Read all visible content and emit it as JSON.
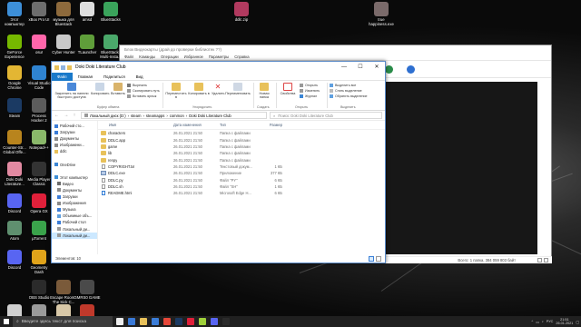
{
  "desktop": {
    "icons": [
      {
        "label": "Этот компьютер",
        "color": "#3d8fd8"
      },
      {
        "label": "xBox Pro UI",
        "color": "#6e6e6e"
      },
      {
        "label": "музыка для Bluestack",
        "color": "#8e6a3c"
      },
      {
        "label": "amsd",
        "color": "#dddddd"
      },
      {
        "label": "BlueStacks",
        "color": "#3aa35b"
      },
      {
        "label": "GeForce Experience",
        "color": "#76b900"
      },
      {
        "label": "osu!",
        "color": "#ff66aa"
      },
      {
        "label": "Cyber Hunter",
        "color": "#c9c9c9"
      },
      {
        "label": "TLauncher",
        "color": "#5f9e3a"
      },
      {
        "label": "BlueStacks Multi-Insta...",
        "color": "#4aa86a"
      },
      {
        "label": "Google Chrome",
        "color": "#e3b633"
      },
      {
        "label": "Visual Studio Code",
        "color": "#2f83d1"
      },
      {
        "label": "Steam",
        "color": "#1b3a63"
      },
      {
        "label": "Process Hacker 2",
        "color": "#5c5c5c"
      },
      {
        "label": "Counter-Str... Global Offe...",
        "color": "#b8841d"
      },
      {
        "label": "Notepad++",
        "color": "#8ab86a"
      },
      {
        "label": "Doki Doki Literature...",
        "color": "#e28aa2"
      },
      {
        "label": "Media Player Classic",
        "color": "#333333"
      },
      {
        "label": "Discord",
        "color": "#5865f2"
      },
      {
        "label": "Opera GX",
        "color": "#e0203a"
      },
      {
        "label": "Atom",
        "color": "#5f8f6f"
      },
      {
        "label": "µTorrent",
        "color": "#3aa34b"
      },
      {
        "label": "Discord",
        "color": "#5865f2"
      },
      {
        "label": "Geometry Dash",
        "color": "#e0a31a"
      },
      {
        "label": "OBS Studio",
        "color": "#2b2b2b"
      },
      {
        "label": "Escape Room - The Sick C...",
        "color": "#7a5a3a"
      },
      {
        "label": "GMRS0 GAME",
        "color": "#4a4a4a"
      },
      {
        "label": "HitmanPro",
        "color": "#d0d0d0"
      },
      {
        "label": "Destiny 2",
        "color": "#9a9a9a"
      },
      {
        "label": "Genshin Impact",
        "color": "#d8c8a8"
      },
      {
        "label": "Intellism",
        "color": "#c0392b"
      },
      {
        "label": "ddlc.zip",
        "color": "#b13a5f"
      },
      {
        "label": "true happiness.exe",
        "color": "#7a6a6a"
      }
    ]
  },
  "back_window": {
    "title": "Блок Видеокарты (драй до проверки библиотек ??)",
    "menu": [
      "Файл",
      "Команды",
      "Операции",
      "Избранное",
      "Параметры",
      "Справка"
    ],
    "status_left": "нф",
    "status_right": "Всего: 1 папка, 384 059 803 байт"
  },
  "explorer": {
    "title": "Doki Doki Literature Club",
    "tabs": [
      "Файл",
      "Главная",
      "Поделиться",
      "Вид"
    ],
    "ribbon": {
      "pin": "Закрепить на панели быстрого доступа",
      "copy": "Копировать",
      "paste": "Вставить",
      "cut": "Вырезать",
      "copy_path": "Скопировать путь",
      "paste_shortcut": "Вставить ярлык",
      "clipboard_group": "Буфер обмена",
      "move_to": "Переместить в",
      "copy_to": "Копировать в",
      "delete": "Удалить",
      "rename": "Переименовать",
      "organize_group": "Упорядочить",
      "new_folder": "Новая папка",
      "create_group": "Создать",
      "properties": "Свойства",
      "open": "Открыть",
      "edit": "Изменить",
      "history": "Журнал",
      "open_group": "Открыть",
      "select_all": "Выделить все",
      "select_none": "Снять выделение",
      "invert_selection": "Обратить выделение",
      "select_group": "Выделить"
    },
    "address": {
      "nav": "← → ↑",
      "crumbs": [
        "Локальный диск (D:)",
        "steam",
        "steamapps",
        "common",
        "Doki Doki Literature Club"
      ],
      "search_placeholder": "Поиск: Doki Doki Literature Club"
    },
    "nav_pane": [
      {
        "label": "Рабочий сто...",
        "indent": false,
        "color": "#3b7dd8"
      },
      {
        "label": "Загрузки",
        "indent": false,
        "color": "#3b7dd8"
      },
      {
        "label": "Документы",
        "indent": false,
        "color": "#8a8a8a"
      },
      {
        "label": "Изображени...",
        "indent": false,
        "color": "#8a8a8a"
      },
      {
        "label": "ddlc",
        "indent": false,
        "color": "#e8c15a"
      },
      {
        "label": "",
        "indent": false,
        "color": "#ffffff"
      },
      {
        "label": "OneDrive",
        "indent": false,
        "color": "#3a86d6"
      },
      {
        "label": "",
        "indent": false,
        "color": "#ffffff"
      },
      {
        "label": "Этот компьютер",
        "indent": false,
        "color": "#3d8fd8"
      },
      {
        "label": "Видео",
        "indent": true,
        "color": "#6b6b6b"
      },
      {
        "label": "Документы",
        "indent": true,
        "color": "#8a8a8a"
      },
      {
        "label": "Загрузки",
        "indent": true,
        "color": "#3b7dd8"
      },
      {
        "label": "Изображения",
        "indent": true,
        "color": "#8a8a8a"
      },
      {
        "label": "Музыка",
        "indent": true,
        "color": "#3b7dd8"
      },
      {
        "label": "Объемные объ...",
        "indent": true,
        "color": "#5fa0e0"
      },
      {
        "label": "Рабочий стол",
        "indent": true,
        "color": "#3b7dd8"
      },
      {
        "label": "Локальный ди...",
        "indent": true,
        "color": "#999999"
      },
      {
        "label": "Локальный ди...",
        "indent": true,
        "color": "#999999",
        "selected": true
      }
    ],
    "columns": {
      "name": "Имя",
      "date": "Дата изменения",
      "type": "Тип",
      "size": "Размер"
    },
    "files": [
      {
        "name": "characters",
        "date": "26.01.2021 21:50",
        "type": "Папка с файлами",
        "size": "",
        "kind": "folder"
      },
      {
        "name": "DDLC.app",
        "date": "26.01.2021 21:50",
        "type": "Папка с файлами",
        "size": "",
        "kind": "folder"
      },
      {
        "name": "game",
        "date": "26.01.2021 21:50",
        "type": "Папка с файлами",
        "size": "",
        "kind": "folder"
      },
      {
        "name": "lib",
        "date": "26.01.2021 21:50",
        "type": "Папка с файлами",
        "size": "",
        "kind": "folder"
      },
      {
        "name": "renpy",
        "date": "26.01.2021 21:50",
        "type": "Папка с файлами",
        "size": "",
        "kind": "folder"
      },
      {
        "name": "COPYRIGHT.txt",
        "date": "26.01.2021 21:50",
        "type": "Текстовый докум...",
        "size": "1 КБ",
        "kind": "doc"
      },
      {
        "name": "DDLC.exe",
        "date": "26.01.2021 21:50",
        "type": "Приложение",
        "size": "377 КБ",
        "kind": "exe"
      },
      {
        "name": "DDLC.py",
        "date": "26.01.2021 21:50",
        "type": "Файл \"PY\"",
        "size": "6 КБ",
        "kind": "doc"
      },
      {
        "name": "DDLC.sh",
        "date": "26.01.2021 21:50",
        "type": "Файл \"SH\"",
        "size": "1 КБ",
        "kind": "doc"
      },
      {
        "name": "README.html",
        "date": "26.01.2021 21:50",
        "type": "Microsoft Edge H...",
        "size": "6 КБ",
        "kind": "html"
      }
    ],
    "status": "Элементов: 10"
  },
  "taskbar": {
    "search_placeholder": "Введите здесь текст для поиска",
    "apps": [
      "#eeeeee",
      "#3a7ad8",
      "#e8c15a",
      "#3b7dd8",
      "#e8483a",
      "#1b3a63",
      "#e0203a",
      "#9fd13a",
      "#5865f2",
      "#2b2b2b"
    ],
    "lang": "РУС",
    "time": "21:51",
    "date": "26.01.2021"
  }
}
